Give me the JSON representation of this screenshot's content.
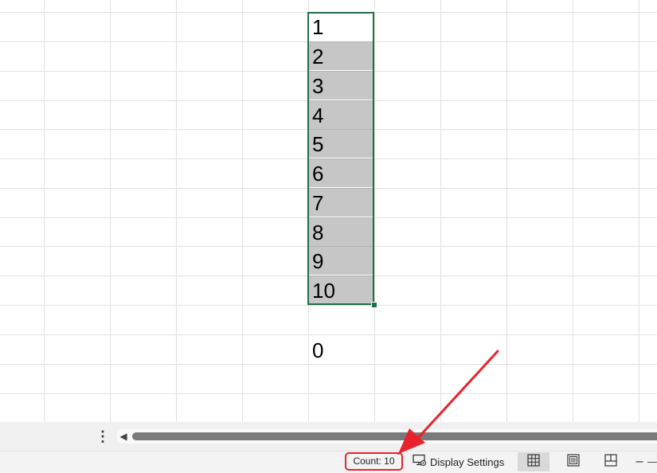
{
  "sheet": {
    "selected_values": [
      "1",
      "2",
      "3",
      "4",
      "5",
      "6",
      "7",
      "8",
      "9",
      "10"
    ],
    "result_cell": "0",
    "selection_color": "#1f7145",
    "highlight_color": "#c6c6c6"
  },
  "status_bar": {
    "count_text": "Count: 10",
    "display_settings_label": "Display Settings",
    "view_buttons": [
      "normal-view",
      "page-layout-view",
      "page-break-preview"
    ]
  },
  "icons": {
    "more": "vertical-dots-icon",
    "scroll_left": "triangle-left-icon",
    "display_settings": "monitor-gear-icon"
  },
  "annotation": {
    "arrow_color": "#e8232b",
    "count_box_color": "#e8232b"
  }
}
